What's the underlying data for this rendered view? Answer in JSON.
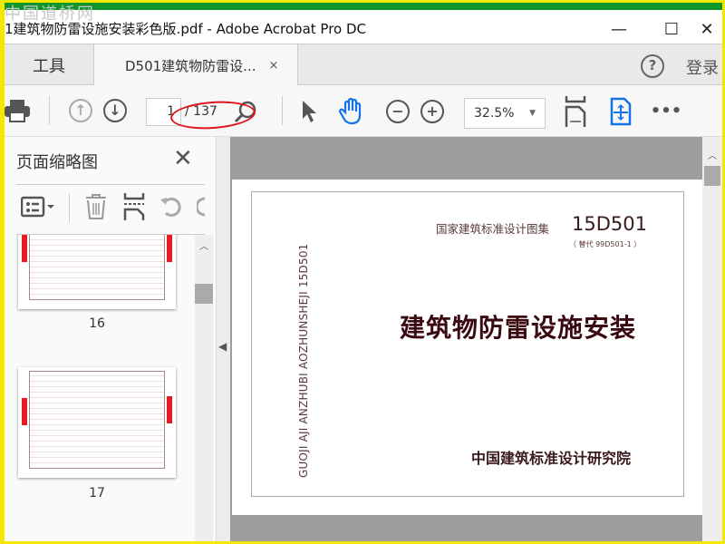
{
  "watermark": "中国道桥网",
  "window": {
    "title": "1建筑物防雷设施安装彩色版.pdf - Adobe Acrobat Pro DC",
    "minimize": "—",
    "maximize": "☐",
    "close": "✕"
  },
  "tabs": {
    "tools": "工具",
    "document": "D501建筑物防雷设...",
    "close": "×"
  },
  "header": {
    "help": "?",
    "login": "登录"
  },
  "toolbar": {
    "current_page": "1",
    "total_pages": "/ 137",
    "zoom": "32.5%"
  },
  "panel": {
    "title": "页面缩略图",
    "close": "✕",
    "thumbnails": [
      {
        "label": "16"
      },
      {
        "label": "17"
      }
    ]
  },
  "document": {
    "series_label": "国家建筑标准设计图集",
    "code": "15D501",
    "replaces": "（ 替代  99D501-1 ）",
    "vertical_text": "GUOJI AJI ANZHUBI AOZHUNSHEJI  15D501",
    "title": "建筑物防雷设施安装",
    "publisher": "中国建筑标准设计研究院"
  },
  "colors": {
    "accent": "#1473e6",
    "title_red": "#3a0a10",
    "highlight_ellipse": "#e0141a",
    "top_bar": "#10952a",
    "border": "#f5e800"
  }
}
